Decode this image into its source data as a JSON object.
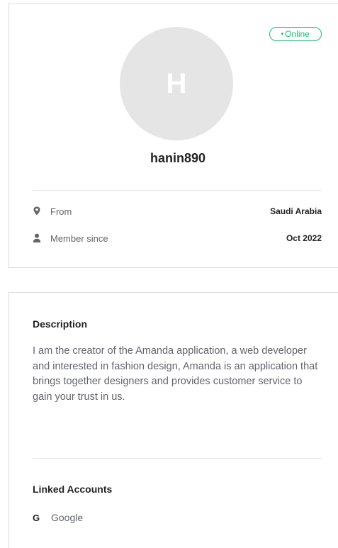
{
  "profile": {
    "status": "Online",
    "avatar_initial": "H",
    "username": "hanin890",
    "info": [
      {
        "icon": "location-pin-icon",
        "label": "From",
        "value": "Saudi Arabia"
      },
      {
        "icon": "user-icon",
        "label": "Member since",
        "value": "Oct 2022"
      }
    ]
  },
  "description": {
    "title": "Description",
    "text": "I am the creator of the Amanda application, a web developer and interested in fashion design, Amanda is an application that brings together designers and provides customer service to gain your trust in us."
  },
  "linked_accounts": {
    "title": "Linked Accounts",
    "items": [
      {
        "icon": "google-icon",
        "icon_glyph": "G",
        "label": "Google"
      }
    ]
  },
  "colors": {
    "online_green": "#1dbf73",
    "avatar_bg": "#e5e5e5",
    "text_primary": "#222325",
    "text_secondary": "#62646a"
  }
}
